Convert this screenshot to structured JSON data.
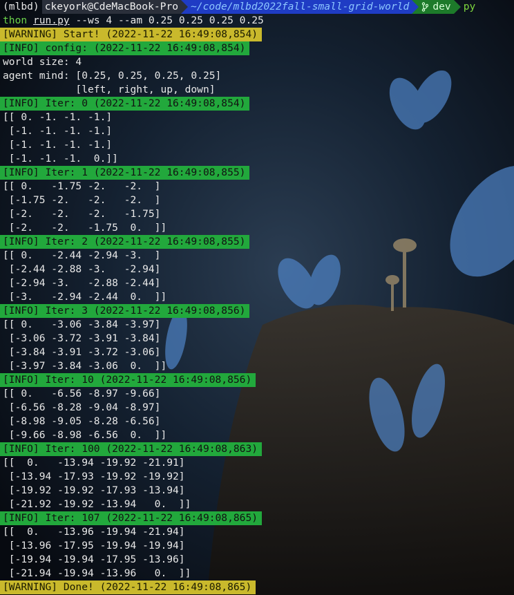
{
  "prompt": {
    "env": "(mlbd)",
    "user_host": "ckeyork@CdeMacBook-Pro",
    "path": "~/code/mlbd2022fall-small-grid-world",
    "git_icon": "git-branch-icon",
    "branch": "dev",
    "lang": "py"
  },
  "command": {
    "head": "thon",
    "file": "run.py",
    "args": " --ws 4 --am 0.25 0.25 0.25 0.25"
  },
  "lines": [
    {
      "type": "warn",
      "text": "[WARNING] Start! (2022-11-22 16:49:08,854)"
    },
    {
      "type": "info",
      "text": "[INFO] config: (2022-11-22 16:49:08,854)"
    },
    {
      "type": "plain",
      "text": "world size: 4"
    },
    {
      "type": "plain",
      "text": "agent mind: [0.25, 0.25, 0.25, 0.25]"
    },
    {
      "type": "plain",
      "text": "            [left, right, up, down]"
    },
    {
      "type": "info",
      "text": "[INFO] Iter: 0 (2022-11-22 16:49:08,854)"
    },
    {
      "type": "plain",
      "text": "[[ 0. -1. -1. -1.]"
    },
    {
      "type": "plain",
      "text": " [-1. -1. -1. -1.]"
    },
    {
      "type": "plain",
      "text": " [-1. -1. -1. -1.]"
    },
    {
      "type": "plain",
      "text": " [-1. -1. -1.  0.]]"
    },
    {
      "type": "info",
      "text": "[INFO] Iter: 1 (2022-11-22 16:49:08,855)"
    },
    {
      "type": "plain",
      "text": "[[ 0.   -1.75 -2.   -2.  ]"
    },
    {
      "type": "plain",
      "text": " [-1.75 -2.   -2.   -2.  ]"
    },
    {
      "type": "plain",
      "text": " [-2.   -2.   -2.   -1.75]"
    },
    {
      "type": "plain",
      "text": " [-2.   -2.   -1.75  0.  ]]"
    },
    {
      "type": "info",
      "text": "[INFO] Iter: 2 (2022-11-22 16:49:08,855)"
    },
    {
      "type": "plain",
      "text": "[[ 0.   -2.44 -2.94 -3.  ]"
    },
    {
      "type": "plain",
      "text": " [-2.44 -2.88 -3.   -2.94]"
    },
    {
      "type": "plain",
      "text": " [-2.94 -3.   -2.88 -2.44]"
    },
    {
      "type": "plain",
      "text": " [-3.   -2.94 -2.44  0.  ]]"
    },
    {
      "type": "info",
      "text": "[INFO] Iter: 3 (2022-11-22 16:49:08,856)"
    },
    {
      "type": "plain",
      "text": "[[ 0.   -3.06 -3.84 -3.97]"
    },
    {
      "type": "plain",
      "text": " [-3.06 -3.72 -3.91 -3.84]"
    },
    {
      "type": "plain",
      "text": " [-3.84 -3.91 -3.72 -3.06]"
    },
    {
      "type": "plain",
      "text": " [-3.97 -3.84 -3.06  0.  ]]"
    },
    {
      "type": "info",
      "text": "[INFO] Iter: 10 (2022-11-22 16:49:08,856)"
    },
    {
      "type": "plain",
      "text": "[[ 0.   -6.56 -8.97 -9.66]"
    },
    {
      "type": "plain",
      "text": " [-6.56 -8.28 -9.04 -8.97]"
    },
    {
      "type": "plain",
      "text": " [-8.98 -9.05 -8.28 -6.56]"
    },
    {
      "type": "plain",
      "text": " [-9.66 -8.98 -6.56  0.  ]]"
    },
    {
      "type": "info",
      "text": "[INFO] Iter: 100 (2022-11-22 16:49:08,863)"
    },
    {
      "type": "plain",
      "text": "[[  0.   -13.94 -19.92 -21.91]"
    },
    {
      "type": "plain",
      "text": " [-13.94 -17.93 -19.92 -19.92]"
    },
    {
      "type": "plain",
      "text": " [-19.92 -19.92 -17.93 -13.94]"
    },
    {
      "type": "plain",
      "text": " [-21.92 -19.92 -13.94   0.  ]]"
    },
    {
      "type": "info",
      "text": "[INFO] Iter: 107 (2022-11-22 16:49:08,865)"
    },
    {
      "type": "plain",
      "text": "[[  0.   -13.96 -19.94 -21.94]"
    },
    {
      "type": "plain",
      "text": " [-13.96 -17.95 -19.94 -19.94]"
    },
    {
      "type": "plain",
      "text": " [-19.94 -19.94 -17.95 -13.96]"
    },
    {
      "type": "plain",
      "text": " [-21.94 -19.94 -13.96   0.  ]]"
    },
    {
      "type": "warn",
      "text": "[WARNING] Done! (2022-11-22 16:49:08,865)"
    }
  ],
  "colors": {
    "info_bg": "#22a83c",
    "warn_bg": "#c9b92c",
    "path_bg": "#1f3cc4",
    "git_bg": "#1d7a2a"
  }
}
